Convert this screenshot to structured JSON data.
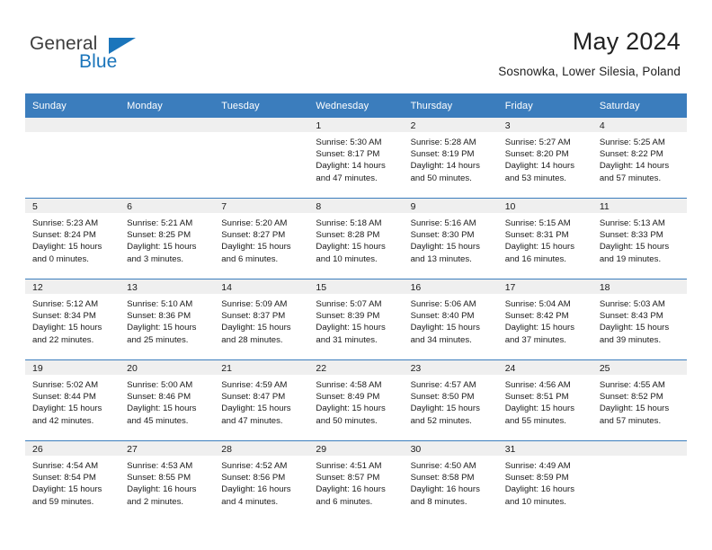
{
  "brand": {
    "name_part1": "General",
    "name_part2": "Blue",
    "accent_color": "#1b75bb"
  },
  "header": {
    "month_title": "May 2024",
    "location": "Sosnowka, Lower Silesia, Poland"
  },
  "theme": {
    "header_band": "#3b7dbd",
    "daynum_band": "#efefef",
    "text": "#1a1a1a"
  },
  "calendar": {
    "weekday_headers": [
      "Sunday",
      "Monday",
      "Tuesday",
      "Wednesday",
      "Thursday",
      "Friday",
      "Saturday"
    ],
    "weeks": [
      [
        {
          "day": "",
          "sunrise": "",
          "sunset": "",
          "daylight1": "",
          "daylight2": ""
        },
        {
          "day": "",
          "sunrise": "",
          "sunset": "",
          "daylight1": "",
          "daylight2": ""
        },
        {
          "day": "",
          "sunrise": "",
          "sunset": "",
          "daylight1": "",
          "daylight2": ""
        },
        {
          "day": "1",
          "sunrise": "Sunrise: 5:30 AM",
          "sunset": "Sunset: 8:17 PM",
          "daylight1": "Daylight: 14 hours",
          "daylight2": "and 47 minutes."
        },
        {
          "day": "2",
          "sunrise": "Sunrise: 5:28 AM",
          "sunset": "Sunset: 8:19 PM",
          "daylight1": "Daylight: 14 hours",
          "daylight2": "and 50 minutes."
        },
        {
          "day": "3",
          "sunrise": "Sunrise: 5:27 AM",
          "sunset": "Sunset: 8:20 PM",
          "daylight1": "Daylight: 14 hours",
          "daylight2": "and 53 minutes."
        },
        {
          "day": "4",
          "sunrise": "Sunrise: 5:25 AM",
          "sunset": "Sunset: 8:22 PM",
          "daylight1": "Daylight: 14 hours",
          "daylight2": "and 57 minutes."
        }
      ],
      [
        {
          "day": "5",
          "sunrise": "Sunrise: 5:23 AM",
          "sunset": "Sunset: 8:24 PM",
          "daylight1": "Daylight: 15 hours",
          "daylight2": "and 0 minutes."
        },
        {
          "day": "6",
          "sunrise": "Sunrise: 5:21 AM",
          "sunset": "Sunset: 8:25 PM",
          "daylight1": "Daylight: 15 hours",
          "daylight2": "and 3 minutes."
        },
        {
          "day": "7",
          "sunrise": "Sunrise: 5:20 AM",
          "sunset": "Sunset: 8:27 PM",
          "daylight1": "Daylight: 15 hours",
          "daylight2": "and 6 minutes."
        },
        {
          "day": "8",
          "sunrise": "Sunrise: 5:18 AM",
          "sunset": "Sunset: 8:28 PM",
          "daylight1": "Daylight: 15 hours",
          "daylight2": "and 10 minutes."
        },
        {
          "day": "9",
          "sunrise": "Sunrise: 5:16 AM",
          "sunset": "Sunset: 8:30 PM",
          "daylight1": "Daylight: 15 hours",
          "daylight2": "and 13 minutes."
        },
        {
          "day": "10",
          "sunrise": "Sunrise: 5:15 AM",
          "sunset": "Sunset: 8:31 PM",
          "daylight1": "Daylight: 15 hours",
          "daylight2": "and 16 minutes."
        },
        {
          "day": "11",
          "sunrise": "Sunrise: 5:13 AM",
          "sunset": "Sunset: 8:33 PM",
          "daylight1": "Daylight: 15 hours",
          "daylight2": "and 19 minutes."
        }
      ],
      [
        {
          "day": "12",
          "sunrise": "Sunrise: 5:12 AM",
          "sunset": "Sunset: 8:34 PM",
          "daylight1": "Daylight: 15 hours",
          "daylight2": "and 22 minutes."
        },
        {
          "day": "13",
          "sunrise": "Sunrise: 5:10 AM",
          "sunset": "Sunset: 8:36 PM",
          "daylight1": "Daylight: 15 hours",
          "daylight2": "and 25 minutes."
        },
        {
          "day": "14",
          "sunrise": "Sunrise: 5:09 AM",
          "sunset": "Sunset: 8:37 PM",
          "daylight1": "Daylight: 15 hours",
          "daylight2": "and 28 minutes."
        },
        {
          "day": "15",
          "sunrise": "Sunrise: 5:07 AM",
          "sunset": "Sunset: 8:39 PM",
          "daylight1": "Daylight: 15 hours",
          "daylight2": "and 31 minutes."
        },
        {
          "day": "16",
          "sunrise": "Sunrise: 5:06 AM",
          "sunset": "Sunset: 8:40 PM",
          "daylight1": "Daylight: 15 hours",
          "daylight2": "and 34 minutes."
        },
        {
          "day": "17",
          "sunrise": "Sunrise: 5:04 AM",
          "sunset": "Sunset: 8:42 PM",
          "daylight1": "Daylight: 15 hours",
          "daylight2": "and 37 minutes."
        },
        {
          "day": "18",
          "sunrise": "Sunrise: 5:03 AM",
          "sunset": "Sunset: 8:43 PM",
          "daylight1": "Daylight: 15 hours",
          "daylight2": "and 39 minutes."
        }
      ],
      [
        {
          "day": "19",
          "sunrise": "Sunrise: 5:02 AM",
          "sunset": "Sunset: 8:44 PM",
          "daylight1": "Daylight: 15 hours",
          "daylight2": "and 42 minutes."
        },
        {
          "day": "20",
          "sunrise": "Sunrise: 5:00 AM",
          "sunset": "Sunset: 8:46 PM",
          "daylight1": "Daylight: 15 hours",
          "daylight2": "and 45 minutes."
        },
        {
          "day": "21",
          "sunrise": "Sunrise: 4:59 AM",
          "sunset": "Sunset: 8:47 PM",
          "daylight1": "Daylight: 15 hours",
          "daylight2": "and 47 minutes."
        },
        {
          "day": "22",
          "sunrise": "Sunrise: 4:58 AM",
          "sunset": "Sunset: 8:49 PM",
          "daylight1": "Daylight: 15 hours",
          "daylight2": "and 50 minutes."
        },
        {
          "day": "23",
          "sunrise": "Sunrise: 4:57 AM",
          "sunset": "Sunset: 8:50 PM",
          "daylight1": "Daylight: 15 hours",
          "daylight2": "and 52 minutes."
        },
        {
          "day": "24",
          "sunrise": "Sunrise: 4:56 AM",
          "sunset": "Sunset: 8:51 PM",
          "daylight1": "Daylight: 15 hours",
          "daylight2": "and 55 minutes."
        },
        {
          "day": "25",
          "sunrise": "Sunrise: 4:55 AM",
          "sunset": "Sunset: 8:52 PM",
          "daylight1": "Daylight: 15 hours",
          "daylight2": "and 57 minutes."
        }
      ],
      [
        {
          "day": "26",
          "sunrise": "Sunrise: 4:54 AM",
          "sunset": "Sunset: 8:54 PM",
          "daylight1": "Daylight: 15 hours",
          "daylight2": "and 59 minutes."
        },
        {
          "day": "27",
          "sunrise": "Sunrise: 4:53 AM",
          "sunset": "Sunset: 8:55 PM",
          "daylight1": "Daylight: 16 hours",
          "daylight2": "and 2 minutes."
        },
        {
          "day": "28",
          "sunrise": "Sunrise: 4:52 AM",
          "sunset": "Sunset: 8:56 PM",
          "daylight1": "Daylight: 16 hours",
          "daylight2": "and 4 minutes."
        },
        {
          "day": "29",
          "sunrise": "Sunrise: 4:51 AM",
          "sunset": "Sunset: 8:57 PM",
          "daylight1": "Daylight: 16 hours",
          "daylight2": "and 6 minutes."
        },
        {
          "day": "30",
          "sunrise": "Sunrise: 4:50 AM",
          "sunset": "Sunset: 8:58 PM",
          "daylight1": "Daylight: 16 hours",
          "daylight2": "and 8 minutes."
        },
        {
          "day": "31",
          "sunrise": "Sunrise: 4:49 AM",
          "sunset": "Sunset: 8:59 PM",
          "daylight1": "Daylight: 16 hours",
          "daylight2": "and 10 minutes."
        },
        {
          "day": "",
          "sunrise": "",
          "sunset": "",
          "daylight1": "",
          "daylight2": ""
        }
      ]
    ]
  }
}
